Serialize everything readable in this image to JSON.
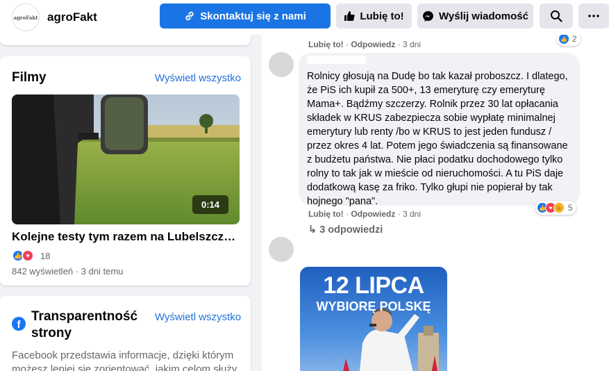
{
  "header": {
    "logo_text": "agroFakt",
    "page_name": "agroFakt",
    "contact_label": "Skontaktuj się z nami",
    "like_label": "Lubię to!",
    "message_label": "Wyślij wiadomość",
    "search_icon": "search-icon",
    "more_icon": "more-icon"
  },
  "films": {
    "title": "Filmy",
    "see_all": "Wyświetl wszystko",
    "video": {
      "duration": "0:14",
      "title": "Kolejne testy tym razem na Lubelszczyźnie",
      "reaction_count": "18",
      "meta": "842 wyświetleń · 3 dni temu"
    }
  },
  "transparency": {
    "title": "Transparentność strony",
    "see_all": "Wyświetl wszystko",
    "text": "Facebook przedstawia informacje, dzięki którym możesz lepiej się zorientować, jakim celom służy"
  },
  "comments": {
    "top_meta": {
      "like": "Lubię to!",
      "reply": "Odpowiedz",
      "time": "3 dni",
      "reaction_count": "2"
    },
    "main": {
      "text": "Rolnicy głosują na Dudę bo tak kazał proboszcz. I dlatego, że PiS ich kupił za 500+, 13 emeryturę czy emeryturę Mama+. Bądźmy szczerzy. Rolnik przez 30 lat opłacania składek w KRUS zabezpiecza sobie wypłatę minimalnej emerytury lub renty /bo w KRUS to jest jeden fundusz / przez okres 4 lat. Potem jego świadczenia są finansowane z budżetu państwa. Nie płaci podatku dochodowego tylko rolny to tak jak w mieście od nieruchomości. A tu PiS daje dodatkową kasę za friko. Tylko głupi nie popierał by tak hojnego \"pana\".",
      "like": "Lubię to!",
      "reply": "Odpowiedz",
      "time": "3 dni",
      "reaction_count": "5",
      "replies_label": "3 odpowiedzi"
    },
    "image_post": {
      "line1": "12 LIPCA",
      "line2": "WYBIORĘ POLSKĘ"
    }
  },
  "colors": {
    "brand_blue": "#1b74e4",
    "link_blue": "#216fdb",
    "like_blue": "#1877f2",
    "love_red": "#f33e58",
    "haha_yellow": "#f7b125"
  }
}
